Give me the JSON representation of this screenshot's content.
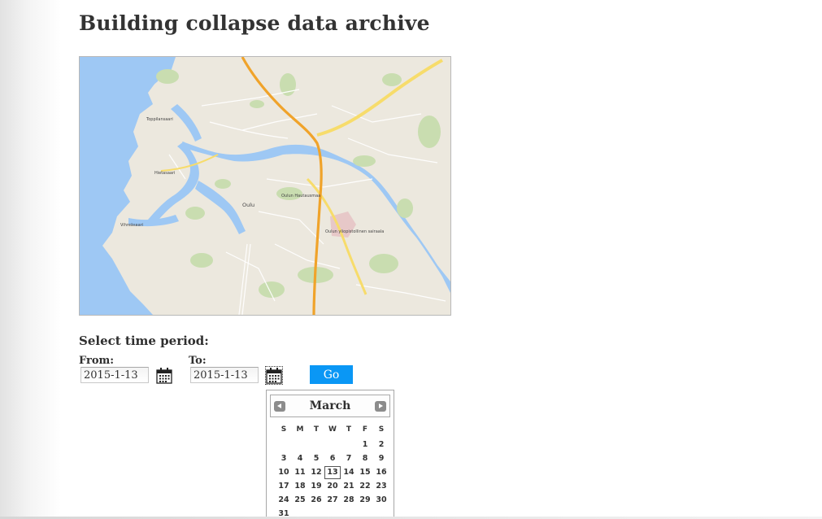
{
  "page": {
    "title": "Building collapse data archive"
  },
  "map": {
    "labels": [
      {
        "text": "Toppilansaari"
      },
      {
        "text": "Hietasaari"
      },
      {
        "text": "Vihreäsaari"
      },
      {
        "text": "Oulu"
      },
      {
        "text": "Oulun yliopistollinen sairaala"
      },
      {
        "text": "Oulun Hautausmaa"
      }
    ],
    "colors": {
      "water": "#99c4f3",
      "land": "#ece8de",
      "park": "#c9ddb0",
      "motorway": "#f0a32a",
      "highway": "#f7dc6b"
    }
  },
  "time_period": {
    "heading": "Select time period:",
    "from_label": "From:",
    "to_label": "To:",
    "from_value": "2015-1-13",
    "to_value": "2015-1-13",
    "go_label": "Go",
    "calendar_icon": "calendar-icon"
  },
  "calendar": {
    "month": "March",
    "prev_icon": "triangle-left-icon",
    "next_icon": "triangle-right-icon",
    "weekdays": [
      "S",
      "M",
      "T",
      "W",
      "T",
      "F",
      "S"
    ],
    "weeks": [
      [
        "",
        "",
        "",
        "",
        "",
        "1",
        "2"
      ],
      [
        "3",
        "4",
        "5",
        "6",
        "7",
        "8",
        "9"
      ],
      [
        "10",
        "11",
        "12",
        "13",
        "14",
        "15",
        "16"
      ],
      [
        "17",
        "18",
        "19",
        "20",
        "21",
        "22",
        "23"
      ],
      [
        "24",
        "25",
        "26",
        "27",
        "28",
        "29",
        "30"
      ],
      [
        "31",
        "",
        "",
        "",
        "",
        "",
        ""
      ]
    ],
    "selected_day": "13"
  }
}
